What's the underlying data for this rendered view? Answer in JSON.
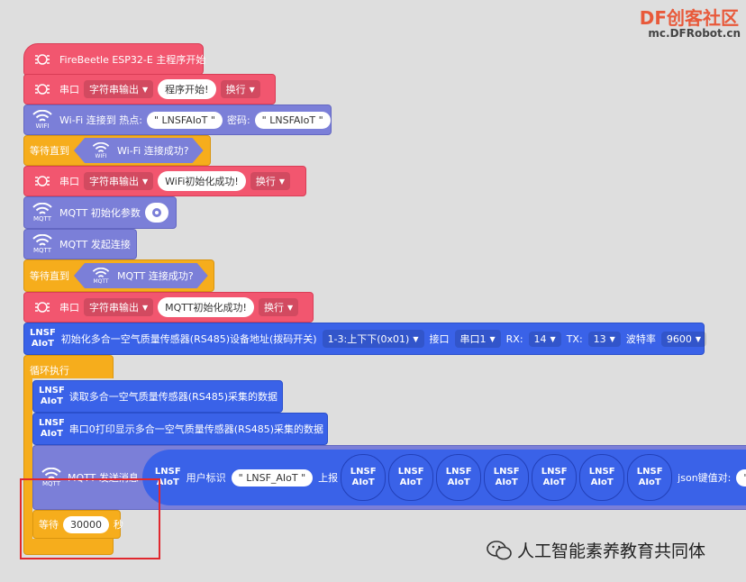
{
  "watermark": {
    "brand_df": "DF",
    "brand_cn": "创客社区",
    "site": "mc.DFRobot.cn",
    "footer": "人工智能素养教育共同体"
  },
  "blocks": {
    "start": {
      "label": "FireBeetle ESP32-E 主程序开始"
    },
    "serial1": {
      "label": "串口",
      "mode": "字符串输出",
      "text": "程序开始!",
      "newline": "换行"
    },
    "wifi_connect": {
      "label1": "Wi-Fi 连接到 热点:",
      "ssid": "\" LNSFAIoT \"",
      "label2": "密码:",
      "password": "\" LNSFAIoT \"",
      "icon_caption": "WIFI"
    },
    "wait_wifi": {
      "label": "等待直到",
      "cond": "Wi-Fi 连接成功?",
      "icon_caption": "WIFI"
    },
    "serial2": {
      "label": "串口",
      "mode": "字符串输出",
      "text": "WiFi初始化成功!",
      "newline": "换行"
    },
    "mqtt_init": {
      "label": "MQTT 初始化参数",
      "icon_caption": "MQTT"
    },
    "mqtt_connect": {
      "label": "MQTT 发起连接",
      "icon_caption": "MQTT"
    },
    "wait_mqtt": {
      "label": "等待直到",
      "cond": "MQTT 连接成功?",
      "icon_caption": "MQTT"
    },
    "serial3": {
      "label": "串口",
      "mode": "字符串输出",
      "text": "MQTT初始化成功!",
      "newline": "换行"
    },
    "sensor_init": {
      "lnsf1": "LNSF",
      "lnsf2": "AIoT",
      "label": "初始化多合一空气质量传感器(RS485)设备地址(拨码开关)",
      "addr": "1-3:上下下(0x01)",
      "port_label": "接口",
      "port": "串口1",
      "rx_label": "RX:",
      "rx": "14",
      "tx_label": "TX:",
      "tx": "13",
      "baud_label": "波特率",
      "baud": "9600"
    },
    "loop": {
      "label": "循环执行"
    },
    "read": {
      "label": "读取多合一空气质量传感器(RS485)采集的数据"
    },
    "print": {
      "label": "串口0打印显示多合一空气质量传感器(RS485)采集的数据"
    },
    "mqtt_send": {
      "label": "MQTT 发送消息",
      "user_label": "用户标识",
      "user": "\" LNSF_AIoT \"",
      "report": "上报",
      "json_label": "json键值对:",
      "json_partial": "\" te",
      "icon_caption": "MQTT"
    },
    "wait": {
      "label": "等待",
      "value": "30000",
      "unit": "秒"
    }
  }
}
